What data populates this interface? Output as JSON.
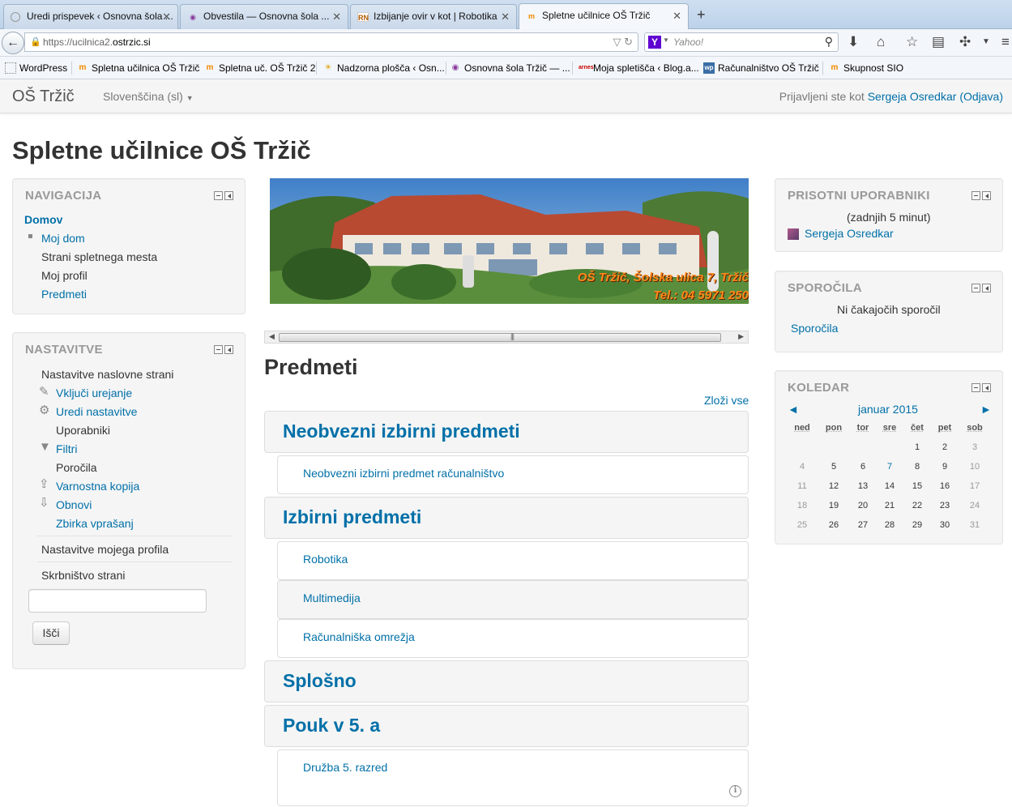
{
  "browser": {
    "tabs": [
      {
        "title": "Uredi prispevek ‹ Osnovna šola ...",
        "icon": "wordpress"
      },
      {
        "title": "Obvestila — Osnovna šola ...",
        "icon": "school-logo"
      },
      {
        "title": "Izbijanje ovir v kot | Robotika",
        "icon": "RN"
      },
      {
        "title": "Spletne učilnice OŠ Tržič",
        "icon": "moodle"
      }
    ],
    "url_prefix": "https://ucilnica2.",
    "url_domain": "ostrzic.si",
    "search_placeholder": "Yahoo!",
    "search_engine_letter": "Y",
    "bookmarks": [
      {
        "label": "WordPress",
        "icon": "page"
      },
      {
        "label": "Spletna učilnica OŠ Tržič",
        "icon": "moodle"
      },
      {
        "label": "Spletna uč. OŠ Tržič 2",
        "icon": "moodle"
      },
      {
        "label": "Nadzorna plošča ‹ Osn...",
        "icon": "sun"
      },
      {
        "label": "Osnovna šola Tržič — ...",
        "icon": "school-logo"
      },
      {
        "label": "Moja spletišča ‹ Blog.a...",
        "icon": "arnes"
      },
      {
        "label": "Računalništvo OŠ Tržič",
        "icon": "wp"
      },
      {
        "label": "Skupnost SIO",
        "icon": "moodle"
      }
    ]
  },
  "header": {
    "brand": "OŠ Tržič",
    "language": "Slovenščina (sl)",
    "login_prefix": "Prijavljeni ste kot",
    "user": "Sergeja Osredkar",
    "logout": "(Odjava)"
  },
  "page_title": "Spletne učilnice OŠ Tržič",
  "navigation": {
    "heading": "NAVIGACIJA",
    "home": "Domov",
    "items": [
      "Moj dom",
      "Strani spletnega mesta",
      "Moj profil",
      "Predmeti"
    ]
  },
  "settings": {
    "heading": "NASTAVITVE",
    "frontpage": "Nastavitve naslovne strani",
    "items": [
      "Vključi urejanje",
      "Uredi nastavitve",
      "Uporabniki",
      "Filtri",
      "Poročila",
      "Varnostna kopija",
      "Obnovi",
      "Zbirka vprašanj"
    ],
    "profile": "Nastavitve mojega profila",
    "admin": "Skrbništvo strani",
    "search_button": "Išči"
  },
  "banner": {
    "line1": "OŠ Tržič, Šolska ulica 7, Tržič",
    "line2": "Tel.: 04 5971 250"
  },
  "courses": {
    "heading": "Predmeti",
    "collapse_all": "Zloži vse",
    "categories": [
      {
        "name": "Neobvezni izbirni predmeti",
        "courses": [
          "Neobvezni izbirni predmet računalništvo"
        ]
      },
      {
        "name": "Izbirni predmeti",
        "courses": [
          "Robotika",
          "Multimedija",
          "Računalniška omrežja"
        ]
      },
      {
        "name": "Splošno",
        "courses": []
      },
      {
        "name": "Pouk v 5. a",
        "courses": [
          "Družba 5. razred"
        ]
      }
    ]
  },
  "online_users": {
    "heading": "PRISOTNI UPORABNIKI",
    "period": "(zadnjih 5 minut)",
    "users": [
      "Sergeja Osredkar"
    ]
  },
  "messages": {
    "heading": "SPOROČILA",
    "empty": "Ni čakajočih sporočil",
    "link": "Sporočila"
  },
  "calendar": {
    "heading": "KOLEDAR",
    "month": "januar 2015",
    "prev": "◄",
    "next": "►",
    "days": [
      "ned",
      "pon",
      "tor",
      "sre",
      "čet",
      "pet",
      "sob"
    ],
    "weeks": [
      [
        "",
        "",
        "",
        "",
        "1",
        "2",
        "3"
      ],
      [
        "4",
        "5",
        "6",
        "7",
        "8",
        "9",
        "10"
      ],
      [
        "11",
        "12",
        "13",
        "14",
        "15",
        "16",
        "17"
      ],
      [
        "18",
        "19",
        "20",
        "21",
        "22",
        "23",
        "24"
      ],
      [
        "25",
        "26",
        "27",
        "28",
        "29",
        "30",
        "31"
      ]
    ],
    "today": "7"
  }
}
